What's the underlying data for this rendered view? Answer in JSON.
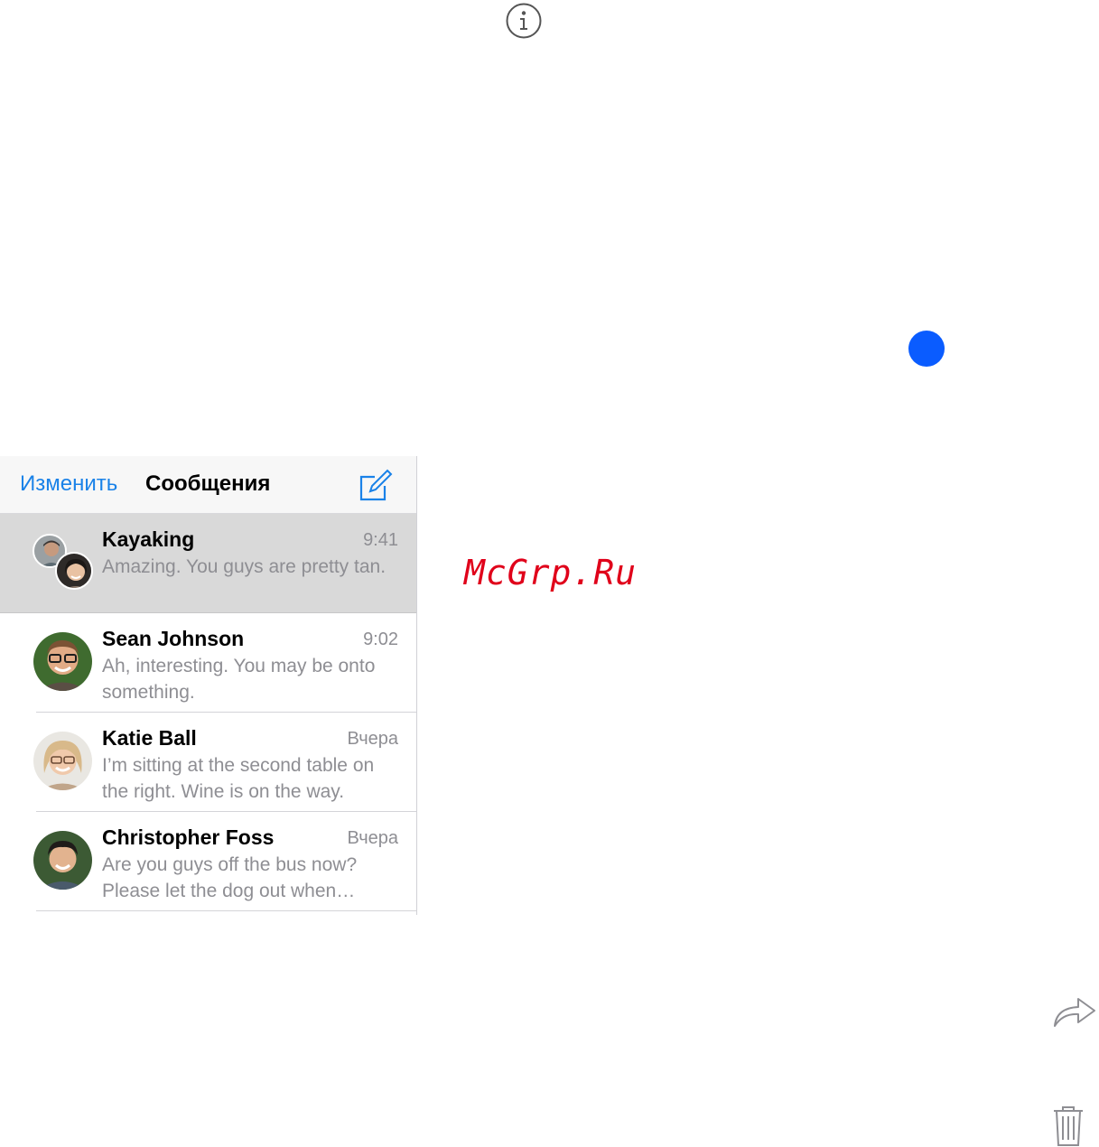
{
  "colors": {
    "accent": "#1a82e8",
    "blue_dot": "#0a5cff",
    "watermark": "#e0001a",
    "icon_gray": "#8e8e93",
    "selected_row": "#d9d9d9"
  },
  "icons": {
    "info": "info-icon",
    "status_dot": "blue-dot",
    "share": "share-icon",
    "trash": "trash-icon",
    "compose": "compose-icon"
  },
  "watermark": "McGrp.Ru",
  "navbar": {
    "edit_label": "Изменить",
    "title": "Сообщения"
  },
  "conversations": [
    {
      "name": "Kayaking",
      "time": "9:41",
      "preview": "Amazing. You guys are pretty tan.",
      "selected": true,
      "group": true
    },
    {
      "name": "Sean Johnson",
      "time": "9:02",
      "preview": "Ah, interesting. You may be onto something.",
      "selected": false,
      "group": false
    },
    {
      "name": "Katie Ball",
      "time": "Вчера",
      "preview": "I’m sitting at the second table on the right. Wine is on the way.",
      "selected": false,
      "group": false
    },
    {
      "name": "Christopher Foss",
      "time": "Вчера",
      "preview": "Are you guys off the bus now? Please let the dog out when…",
      "selected": false,
      "group": false
    }
  ]
}
